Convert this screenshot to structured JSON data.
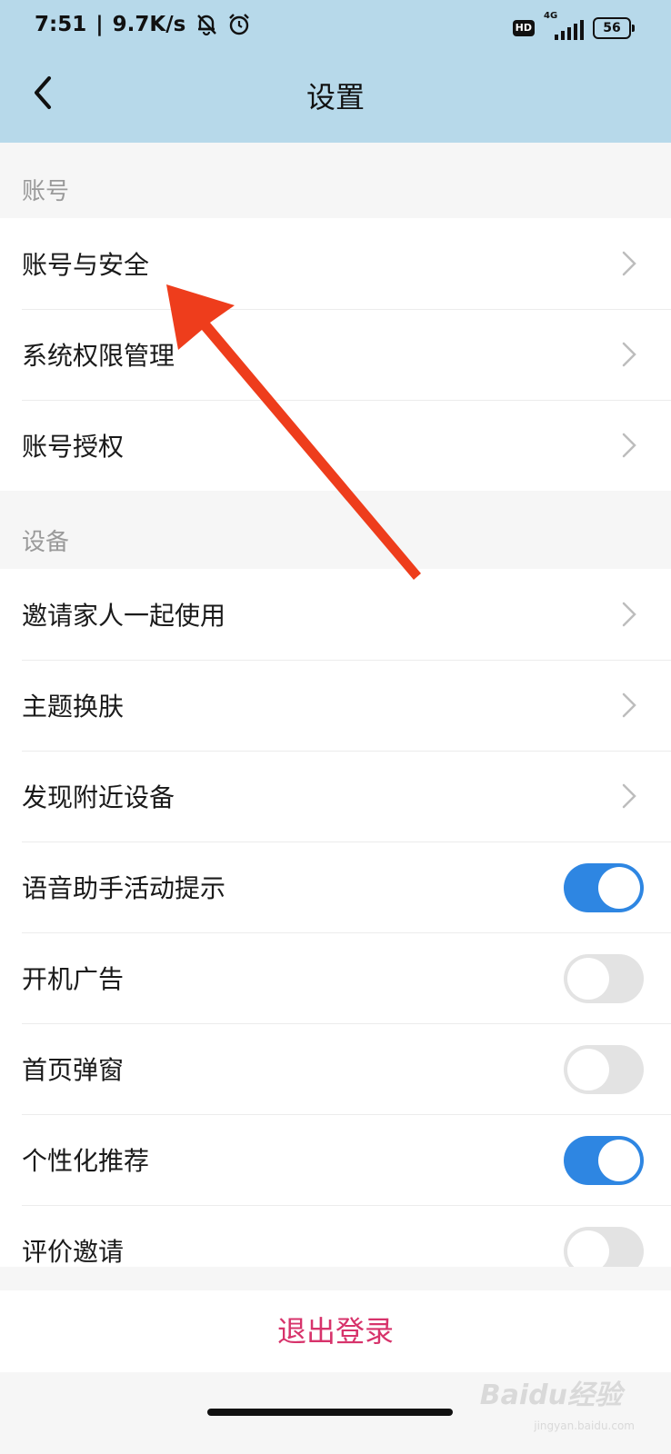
{
  "status_bar": {
    "time": "7:51",
    "speed": "9.7K/s",
    "hd": "HD",
    "network": "4G",
    "battery": "56"
  },
  "header": {
    "title": "设置"
  },
  "sections": [
    {
      "label": "账号",
      "items": [
        {
          "label": "账号与安全",
          "control": "chevron"
        },
        {
          "label": "系统权限管理",
          "control": "chevron"
        },
        {
          "label": "账号授权",
          "control": "chevron"
        }
      ]
    },
    {
      "label": "设备",
      "items": [
        {
          "label": "邀请家人一起使用",
          "control": "chevron"
        },
        {
          "label": "主题换肤",
          "control": "chevron"
        },
        {
          "label": "发现附近设备",
          "control": "chevron"
        },
        {
          "label": "语音助手活动提示",
          "control": "toggle",
          "on": true
        },
        {
          "label": "开机广告",
          "control": "toggle",
          "on": false
        },
        {
          "label": "首页弹窗",
          "control": "toggle",
          "on": false
        },
        {
          "label": "个性化推荐",
          "control": "toggle",
          "on": true
        },
        {
          "label": "评价邀请",
          "control": "toggle",
          "on": false
        }
      ]
    }
  ],
  "logout": {
    "label": "退出登录"
  },
  "watermark": {
    "text": "Baidu经验",
    "sub": "jingyan.baidu.com"
  },
  "colors": {
    "header_bg": "#b7d9ea",
    "toggle_on": "#2e86e2",
    "toggle_off": "#e3e3e3",
    "logout": "#d7336b",
    "annotation_arrow": "#ee3d1c"
  },
  "icons": {
    "back": "chevron-left-icon",
    "row_arrow": "chevron-right-icon",
    "mute": "bell-muted-icon",
    "alarm": "alarm-clock-icon"
  }
}
